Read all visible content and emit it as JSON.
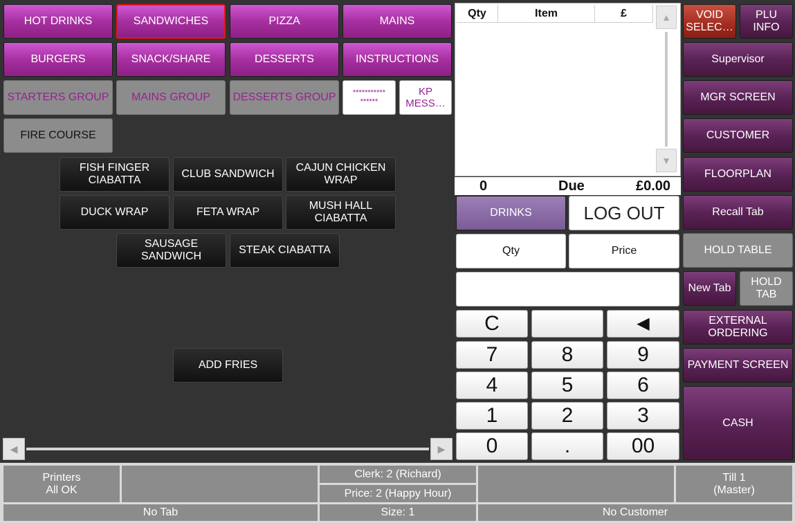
{
  "categories": [
    {
      "label": "HOT DRINKS",
      "selected": false
    },
    {
      "label": "SANDWICHES",
      "selected": true
    },
    {
      "label": "PIZZA",
      "selected": false
    },
    {
      "label": "MAINS",
      "selected": false
    },
    {
      "label": "BURGERS",
      "selected": false
    },
    {
      "label": "SNACK/SHARE",
      "selected": false
    },
    {
      "label": "DESSERTS",
      "selected": false
    },
    {
      "label": "INSTRUCTIONS",
      "selected": false
    }
  ],
  "groups": [
    "STARTERS GROUP",
    "MAINS GROUP",
    "DESSERTS GROUP"
  ],
  "masked_button": "***********\n******",
  "kp_message": "KP\nMESS…",
  "fire_course": "FIRE COURSE",
  "items": [
    "FISH FINGER\nCIABATTA",
    "CLUB SANDWICH",
    "CAJUN CHICKEN\nWRAP",
    "DUCK WRAP",
    "FETA WRAP",
    "MUSH HALL\nCIABATTA",
    "SAUSAGE\nSANDWICH",
    "STEAK CIABATTA"
  ],
  "add_fries": "ADD FRIES",
  "receipt": {
    "col_qty": "Qty",
    "col_item": "Item",
    "col_price": "£",
    "total_qty": "0",
    "due_label": "Due",
    "due_amount": "£0.00"
  },
  "drinks": "DRINKS",
  "logout": "LOG OUT",
  "qty_label": "Qty",
  "price_label": "Price",
  "keypad": [
    "C",
    "",
    "◀",
    "7",
    "8",
    "9",
    "4",
    "5",
    "6",
    "1",
    "2",
    "3",
    "0",
    ".",
    "00"
  ],
  "side": {
    "void": "VOID\nSELEC…",
    "plu_info": "PLU\nINFO",
    "supervisor": "Supervisor",
    "mgr_screen": "MGR SCREEN",
    "customer": "CUSTOMER",
    "floorplan": "FLOORPLAN",
    "recall_tab": "Recall Tab",
    "hold_table": "HOLD TABLE",
    "new_tab": "New Tab",
    "hold_tab": "HOLD\nTAB",
    "external_ordering": "EXTERNAL\nORDERING",
    "payment_screen": "PAYMENT SCREEN",
    "cash": "CASH"
  },
  "status": {
    "printers": "Printers\nAll OK",
    "clerk": "Clerk: 2 (Richard)",
    "price": "Price: 2 (Happy Hour)",
    "till": "Till 1\n(Master)",
    "no_tab": "No Tab",
    "size": "Size: 1",
    "no_customer": "No Customer"
  },
  "colors": {
    "category": "#a6309f",
    "selected_border": "#ee1111",
    "side_button": "#5a2356",
    "void_button": "#a22c1f",
    "background": "#333333"
  }
}
